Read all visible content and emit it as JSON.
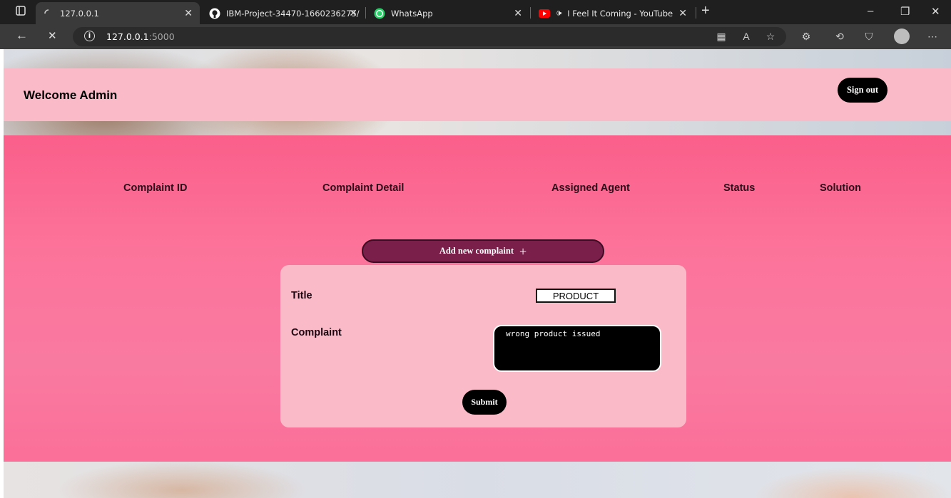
{
  "browser": {
    "tabs": [
      {
        "title": "127.0.0.1",
        "icon": "loading-spinner-icon",
        "active": true
      },
      {
        "title": "IBM-Project-34470-1660236275/",
        "icon": "github-icon",
        "active": false
      },
      {
        "title": "WhatsApp",
        "icon": "whatsapp-icon",
        "active": false
      },
      {
        "title": "I Feel It Coming - YouTube",
        "icon": "youtube-icon",
        "active": false
      }
    ],
    "address": {
      "host": "127.0.0.1",
      "port": ":5000"
    },
    "colors": {
      "chrome_dark": "#1f1f1f",
      "chrome_mid": "#3a3a3a"
    }
  },
  "header": {
    "welcome_text": "Welcome Admin",
    "signout_label": "Sign out"
  },
  "table": {
    "columns": [
      "Complaint ID",
      "Complaint Detail",
      "Assigned Agent",
      "Status",
      "Solution"
    ]
  },
  "add_button": {
    "label": "Add new complaint"
  },
  "form": {
    "title_label": "Title",
    "title_value": "PRODUCT",
    "complaint_label": "Complaint",
    "complaint_value": "wrong product issued",
    "submit_label": "Submit"
  },
  "colors": {
    "header_bg": "#fbbac8",
    "main_bg": "#fa5f8a",
    "add_button_bg": "#7a1f4a",
    "card_bg": "#fbbac8"
  }
}
